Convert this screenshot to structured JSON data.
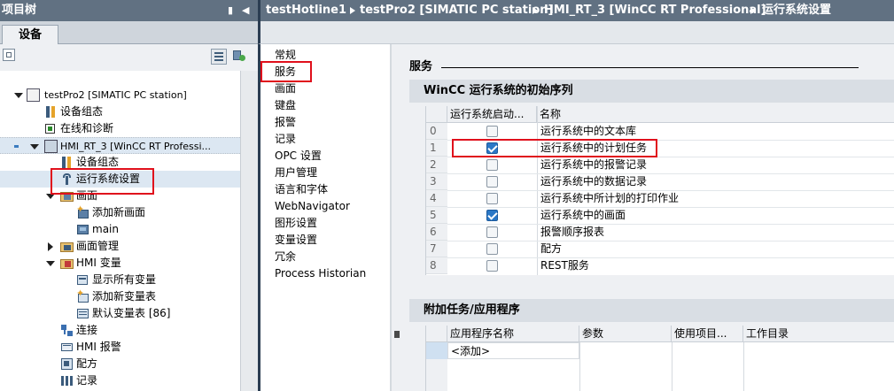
{
  "left_panel": {
    "title": "项目树",
    "collapse_glyph": "◀",
    "pin_glyph": "▮",
    "tab_devices": "设备",
    "tree": [
      {
        "label": "testPro2 [SIMATIC PC station]",
        "icon": "pc-station-icon"
      },
      {
        "label": "设备组态",
        "icon": "device-config-icon"
      },
      {
        "label": "在线和诊断",
        "icon": "online-diagnostics-icon"
      },
      {
        "label": "HMI_RT_3 [WinCC RT Professi...",
        "icon": "hmi-runtime-icon"
      },
      {
        "label": "设备组态",
        "icon": "device-config-icon"
      },
      {
        "label": "运行系统设置",
        "icon": "wrench-icon"
      },
      {
        "label": "画面",
        "icon": "folder-screens-icon"
      },
      {
        "label": "添加新画面",
        "icon": "add-screen-icon"
      },
      {
        "label": "main",
        "icon": "screen-icon"
      },
      {
        "label": "画面管理",
        "icon": "screen-management-icon"
      },
      {
        "label": "HMI 变量",
        "icon": "hmi-tags-icon"
      },
      {
        "label": "显示所有变量",
        "icon": "show-tags-icon"
      },
      {
        "label": "添加新变量表",
        "icon": "add-tag-table-icon"
      },
      {
        "label": "默认变量表 [86]",
        "icon": "tag-table-icon"
      },
      {
        "label": "连接",
        "icon": "connection-icon"
      },
      {
        "label": "HMI 报警",
        "icon": "alarm-icon"
      },
      {
        "label": "配方",
        "icon": "recipe-icon"
      },
      {
        "label": "记录",
        "icon": "logging-icon"
      }
    ]
  },
  "breadcrumb": [
    "testHotline1",
    "testPro2 [SIMATIC PC station]",
    "HMI_RT_3 [WinCC RT Professional]",
    "运行系统设置"
  ],
  "nav": {
    "items": [
      "常规",
      "服务",
      "画面",
      "键盘",
      "报警",
      "记录",
      "OPC 设置",
      "用户管理",
      "语言和字体",
      "WebNavigator",
      "图形设置",
      "变量设置",
      "冗余",
      "Process Historian"
    ]
  },
  "content": {
    "title": "服务",
    "startup": {
      "header": "WinCC 运行系统的初始序列",
      "col_start": "运行系统启动...",
      "col_name": "名称",
      "rows": [
        {
          "num": "0",
          "checked": false,
          "name": "运行系统中的文本库"
        },
        {
          "num": "1",
          "checked": true,
          "name": "运行系统中的计划任务"
        },
        {
          "num": "2",
          "checked": false,
          "name": "运行系统中的报警记录"
        },
        {
          "num": "3",
          "checked": false,
          "name": "运行系统中的数据记录"
        },
        {
          "num": "4",
          "checked": false,
          "name": "运行系统中所计划的打印作业"
        },
        {
          "num": "5",
          "checked": true,
          "name": "运行系统中的画面"
        },
        {
          "num": "6",
          "checked": false,
          "name": "报警顺序报表"
        },
        {
          "num": "7",
          "checked": false,
          "name": "配方"
        },
        {
          "num": "8",
          "checked": false,
          "name": "REST服务"
        }
      ]
    },
    "additional": {
      "header": "附加任务/应用程序",
      "col_app": "应用程序名称",
      "col_params": "参数",
      "col_use": "使用项目...",
      "col_workdir": "工作目录",
      "add_row": "<添加>"
    }
  },
  "colors": {
    "title_bar": "#617182",
    "highlight_red": "#e0101c",
    "checkbox_checked": "#2b78c6"
  }
}
